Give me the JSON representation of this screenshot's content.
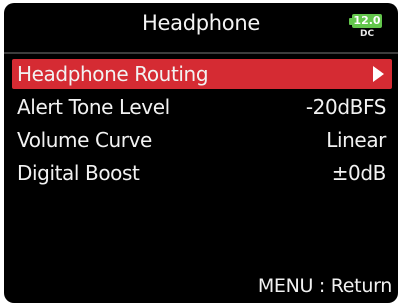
{
  "header": {
    "title": "Headphone",
    "battery_level": "12.0",
    "power_source": "DC",
    "battery_color": "#63c64c"
  },
  "menu": {
    "items": [
      {
        "label": "Headphone Routing",
        "value": "",
        "selected": true,
        "icon": "triangle-right-icon"
      },
      {
        "label": "Alert Tone Level",
        "value": "-20dBFS",
        "selected": false
      },
      {
        "label": "Volume Curve",
        "value": "Linear",
        "selected": false
      },
      {
        "label": "Digital Boost",
        "value": "±0dB",
        "selected": false
      }
    ],
    "highlight_color": "#d52b33"
  },
  "footer": {
    "hint": "MENU : Return"
  }
}
